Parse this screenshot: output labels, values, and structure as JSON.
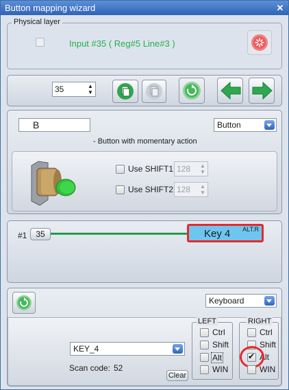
{
  "window": {
    "title": "Button mapping wizard",
    "close_glyph": "✕"
  },
  "physical": {
    "legend": "Physical layer",
    "input_text": "Input #35 ( Reg#5  Line#3 )",
    "input_color": "#22b14c",
    "status_icon": "red-indicator-icon"
  },
  "nav": {
    "number_value": "35",
    "copy_icon": "copy-icon",
    "paste_icon": "paste-icon",
    "reset_icon": "refresh-icon",
    "back_icon": "left-arrow-icon",
    "forward_icon": "right-arrow-icon"
  },
  "button_def": {
    "name_value": "B",
    "type_value": "Button",
    "description": "- Button with momentary action",
    "shift1_label": "Use SHIFT1",
    "shift1_value": "128",
    "shift2_label": "Use SHIFT2",
    "shift2_value": "128"
  },
  "mapping": {
    "index_label": "#1",
    "input_number": "35",
    "key_label": "Key 4",
    "key_modifier": "ALT.R",
    "line_color": "#22b14c",
    "key_color": "#6ec6ee",
    "highlight_color": "#e8282a"
  },
  "output": {
    "device_value": "Keyboard",
    "key_value": "KEY_4",
    "scan_code_label": "Scan code:",
    "scan_code_value": "52",
    "clear_label": "Clear",
    "left_legend": "LEFT",
    "right_legend": "RIGHT",
    "left_mods": [
      {
        "label": "Ctrl",
        "checked": false
      },
      {
        "label": "Shift",
        "checked": false
      },
      {
        "label": "Alt",
        "checked": false
      },
      {
        "label": "WIN",
        "checked": false
      }
    ],
    "right_mods": [
      {
        "label": "Ctrl",
        "checked": false
      },
      {
        "label": "Shift",
        "checked": false
      },
      {
        "label": "Alt",
        "checked": true
      },
      {
        "label": "WIN",
        "checked": false
      }
    ]
  }
}
